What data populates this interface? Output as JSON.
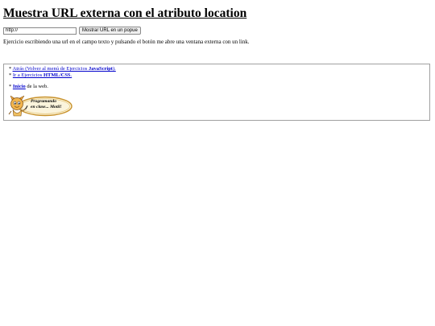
{
  "page": {
    "title": "Muestra URL externa con el atributo location"
  },
  "form": {
    "url_value": "http://",
    "button_label": "Mostrar URL en un popue"
  },
  "description": "Ejercicio escribiendo una url en el campo texto y pulsando el botón me abre una ventana externa con un link.",
  "nav": {
    "bullet": "*",
    "back_prefix": "Atrás (Volver al menú de Ejercicios ",
    "back_strong": "JavaScript",
    "back_suffix": ").",
    "html_prefix": "Ir a Ejercicios ",
    "html_strong": "HTML/CSS",
    "html_suffix": ".",
    "home_strong": "Inicio",
    "home_suffix": " de la web."
  },
  "logo": {
    "line1": "Programando",
    "line2": "en clase... Motil!",
    "icon": "cartoon-character-icon",
    "accent_color": "#c8912a"
  }
}
